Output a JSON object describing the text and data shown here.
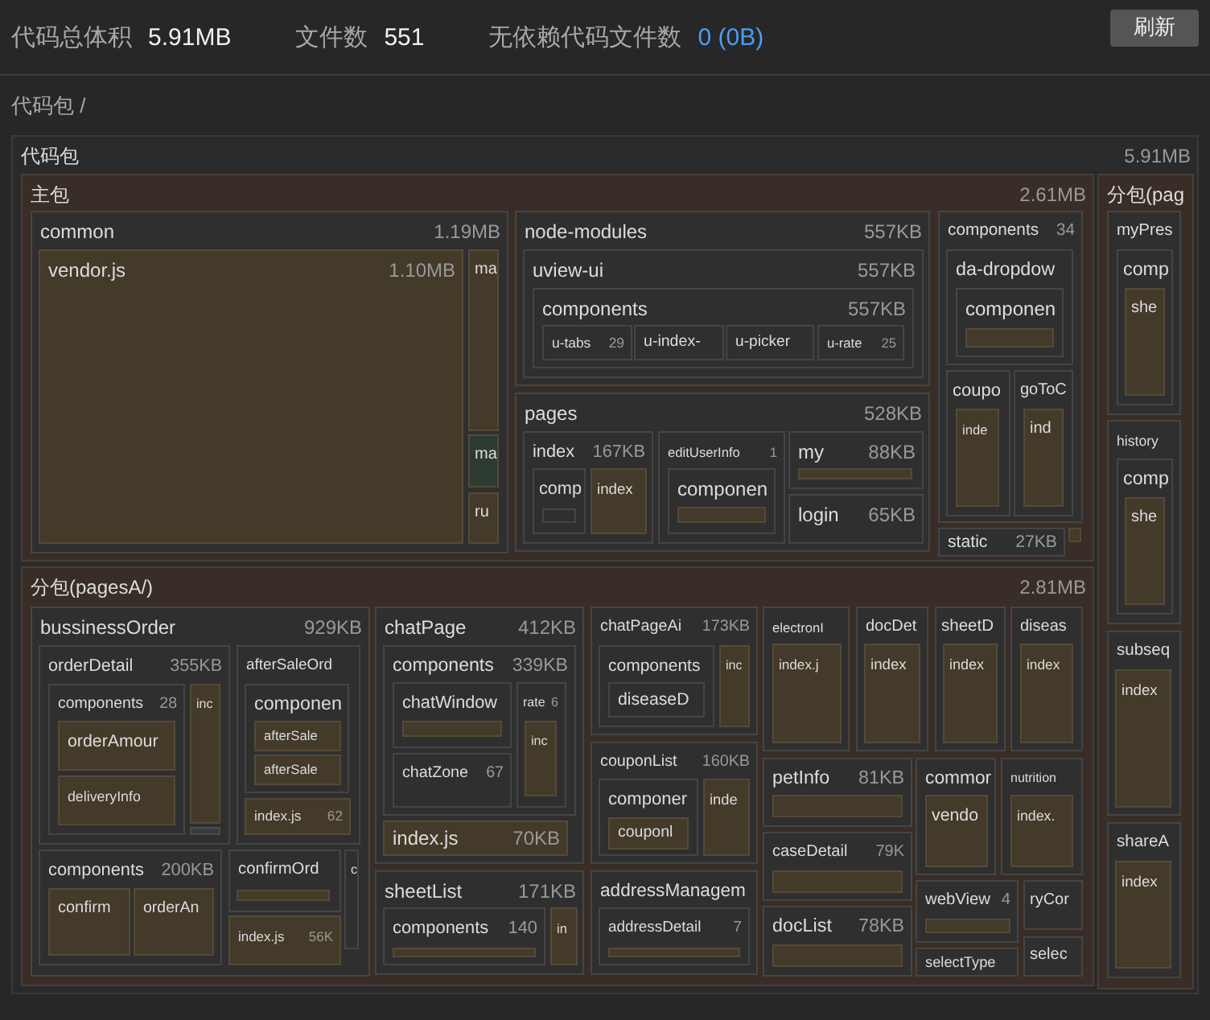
{
  "stats": [
    {
      "label": "代码总体积",
      "value": "5.91MB",
      "highlight": false
    },
    {
      "label": "文件数",
      "value": "551",
      "highlight": false
    },
    {
      "label": "无依赖代码文件数",
      "value": "0 (0B)",
      "highlight": true
    }
  ],
  "refresh_button": "刷新",
  "breadcrumb": "代码包 /",
  "treemap": {
    "kind": "root",
    "name": "代码包",
    "size": "5.91MB",
    "children": [
      {
        "kind": "package",
        "name": "主包",
        "size": "2.61MB",
        "children": [
          {
            "kind": "folder",
            "name": "common",
            "size": "1.19MB",
            "children": [
              {
                "kind": "file",
                "name": "vendor.js",
                "size": "1.10MB"
              },
              {
                "kind": "file",
                "name": "ma"
              },
              {
                "kind": "file",
                "name": "ma",
                "color": "#2c3a31"
              },
              {
                "kind": "file",
                "name": "ru"
              }
            ]
          },
          {
            "kind": "folder",
            "name": "node-modules",
            "size": "557KB",
            "children": [
              {
                "kind": "folder",
                "name": "uview-ui",
                "size": "557KB",
                "children": [
                  {
                    "kind": "folder",
                    "name": "components",
                    "size": "557KB",
                    "children": [
                      {
                        "kind": "folder",
                        "name": "u-tabs",
                        "size": "29"
                      },
                      {
                        "kind": "folder",
                        "name": "u-index-"
                      },
                      {
                        "kind": "folder",
                        "name": "u-picker"
                      },
                      {
                        "kind": "folder",
                        "name": "u-rate",
                        "size": "25"
                      }
                    ]
                  }
                ]
              }
            ]
          },
          {
            "kind": "folder",
            "name": "pages",
            "size": "528KB",
            "children": [
              {
                "kind": "folder",
                "name": "index",
                "size": "167KB",
                "children": [
                  {
                    "kind": "folder",
                    "name": "comp",
                    "children": [
                      {
                        "kind": "folder"
                      }
                    ]
                  },
                  {
                    "kind": "file",
                    "name": "index"
                  }
                ]
              },
              {
                "kind": "folder",
                "name": "editUserInfo",
                "size": "1",
                "children": [
                  {
                    "kind": "folder",
                    "name": "componen",
                    "children": [
                      {
                        "kind": "file"
                      }
                    ]
                  }
                ]
              },
              {
                "kind": "folder",
                "name": "my",
                "size": "88KB",
                "children": [
                  {
                    "kind": "file"
                  }
                ]
              },
              {
                "kind": "folder",
                "name": "login",
                "size": "65KB"
              }
            ]
          },
          {
            "kind": "folder",
            "name": "components",
            "size": "34",
            "children": [
              {
                "kind": "folder",
                "name": "da-dropdow",
                "children": [
                  {
                    "kind": "folder",
                    "name": "componen",
                    "children": [
                      {
                        "kind": "file"
                      }
                    ]
                  }
                ]
              },
              {
                "kind": "folder",
                "name": "coupo",
                "children": [
                  {
                    "kind": "file",
                    "name": "inde"
                  }
                ]
              },
              {
                "kind": "folder",
                "name": "goToC",
                "children": [
                  {
                    "kind": "file",
                    "name": "ind"
                  }
                ]
              }
            ]
          },
          {
            "kind": "folder",
            "name": "static",
            "size": "27KB"
          },
          {
            "kind": "file"
          }
        ]
      },
      {
        "kind": "package",
        "name": "分包(pag",
        "children": [
          {
            "kind": "folder",
            "name": "myPres",
            "children": [
              {
                "kind": "folder",
                "name": "comp",
                "children": [
                  {
                    "kind": "file",
                    "name": "she"
                  }
                ]
              }
            ]
          },
          {
            "kind": "folder",
            "name": "history",
            "children": [
              {
                "kind": "folder",
                "name": "comp",
                "children": [
                  {
                    "kind": "file",
                    "name": "she"
                  }
                ]
              }
            ]
          },
          {
            "kind": "folder",
            "name": "subseq",
            "children": [
              {
                "kind": "file",
                "name": "index"
              }
            ]
          },
          {
            "kind": "folder",
            "name": "shareA",
            "children": [
              {
                "kind": "file",
                "name": "index"
              }
            ]
          }
        ]
      },
      {
        "kind": "package",
        "name": "分包(pagesA/)",
        "size": "2.81MB",
        "children": [
          {
            "kind": "folder",
            "name": "bussinessOrder",
            "size": "929KB",
            "children": [
              {
                "kind": "folder",
                "name": "orderDetail",
                "size": "355KB",
                "children": [
                  {
                    "kind": "folder",
                    "name": "components",
                    "size": "28",
                    "children": [
                      {
                        "kind": "file",
                        "name": "orderAmour"
                      },
                      {
                        "kind": "file",
                        "name": "deliveryInfo"
                      }
                    ]
                  },
                  {
                    "kind": "file",
                    "name": "inc"
                  },
                  {
                    "kind": "file",
                    "color": "#2e3d4a"
                  }
                ]
              },
              {
                "kind": "folder",
                "name": "afterSaleOrd",
                "children": [
                  {
                    "kind": "folder",
                    "name": "componen",
                    "children": [
                      {
                        "kind": "file",
                        "name": "afterSale"
                      },
                      {
                        "kind": "file",
                        "name": "afterSale"
                      }
                    ]
                  },
                  {
                    "kind": "file",
                    "name": "index.js",
                    "size": "62"
                  }
                ]
              },
              {
                "kind": "folder",
                "name": "components",
                "size": "200KB",
                "children": [
                  {
                    "kind": "file",
                    "name": "confirm"
                  },
                  {
                    "kind": "file",
                    "name": "orderAn"
                  }
                ]
              },
              {
                "kind": "folder",
                "name": "confirmOrd",
                "children": [
                  {
                    "kind": "file"
                  }
                ]
              },
              {
                "kind": "file",
                "name": "index.js",
                "size": "56K"
              },
              {
                "kind": "folder",
                "name": "c"
              }
            ]
          },
          {
            "kind": "folder",
            "name": "chatPage",
            "size": "412KB",
            "children": [
              {
                "kind": "folder",
                "name": "components",
                "size": "339KB",
                "children": [
                  {
                    "kind": "folder",
                    "name": "chatWindow",
                    "children": [
                      {
                        "kind": "file"
                      }
                    ]
                  },
                  {
                    "kind": "folder",
                    "name": "chatZone",
                    "size": "67"
                  },
                  {
                    "kind": "folder",
                    "name": "rate",
                    "size": "6",
                    "children": [
                      {
                        "kind": "file",
                        "name": "inc"
                      }
                    ]
                  }
                ]
              },
              {
                "kind": "file",
                "name": "index.js",
                "size": "70KB"
              }
            ]
          },
          {
            "kind": "folder",
            "name": "sheetList",
            "size": "171KB",
            "children": [
              {
                "kind": "folder",
                "name": "components",
                "size": "140",
                "children": [
                  {
                    "kind": "file"
                  }
                ]
              },
              {
                "kind": "file",
                "name": "in"
              }
            ]
          },
          {
            "kind": "folder",
            "name": "chatPageAi",
            "size": "173KB",
            "children": [
              {
                "kind": "folder",
                "name": "components",
                "children": [
                  {
                    "kind": "folder",
                    "name": "diseaseD"
                  }
                ]
              },
              {
                "kind": "file",
                "name": "inc"
              }
            ]
          },
          {
            "kind": "folder",
            "name": "couponList",
            "size": "160KB",
            "children": [
              {
                "kind": "folder",
                "name": "componer",
                "children": [
                  {
                    "kind": "file",
                    "name": "couponl"
                  }
                ]
              },
              {
                "kind": "file",
                "name": "inde"
              }
            ]
          },
          {
            "kind": "folder",
            "name": "addressManagem",
            "children": [
              {
                "kind": "folder",
                "name": "addressDetail",
                "size": "7",
                "children": [
                  {
                    "kind": "file"
                  }
                ]
              }
            ]
          },
          {
            "kind": "folder",
            "name": "electronI",
            "children": [
              {
                "kind": "file",
                "name": "index.j"
              }
            ]
          },
          {
            "kind": "folder",
            "name": "docDet",
            "children": [
              {
                "kind": "file",
                "name": "index"
              }
            ]
          },
          {
            "kind": "folder",
            "name": "sheetD",
            "children": [
              {
                "kind": "file",
                "name": "index"
              }
            ]
          },
          {
            "kind": "folder",
            "name": "diseas",
            "children": [
              {
                "kind": "file",
                "name": "index"
              }
            ]
          },
          {
            "kind": "folder",
            "name": "petInfo",
            "size": "81KB",
            "children": [
              {
                "kind": "file"
              }
            ]
          },
          {
            "kind": "folder",
            "name": "caseDetail",
            "size": "79K",
            "children": [
              {
                "kind": "file"
              }
            ]
          },
          {
            "kind": "folder",
            "name": "docList",
            "size": "78KB",
            "children": [
              {
                "kind": "file"
              }
            ]
          },
          {
            "kind": "folder",
            "name": "commor",
            "children": [
              {
                "kind": "file",
                "name": "vendo"
              }
            ]
          },
          {
            "kind": "folder",
            "name": "nutrition",
            "children": [
              {
                "kind": "file",
                "name": "index."
              }
            ]
          },
          {
            "kind": "folder",
            "name": "webView",
            "size": "4",
            "children": [
              {
                "kind": "file"
              }
            ]
          },
          {
            "kind": "folder",
            "name": "ryCor"
          },
          {
            "kind": "folder",
            "name": "selectType"
          },
          {
            "kind": "folder",
            "name": "selec"
          }
        ]
      }
    ]
  }
}
